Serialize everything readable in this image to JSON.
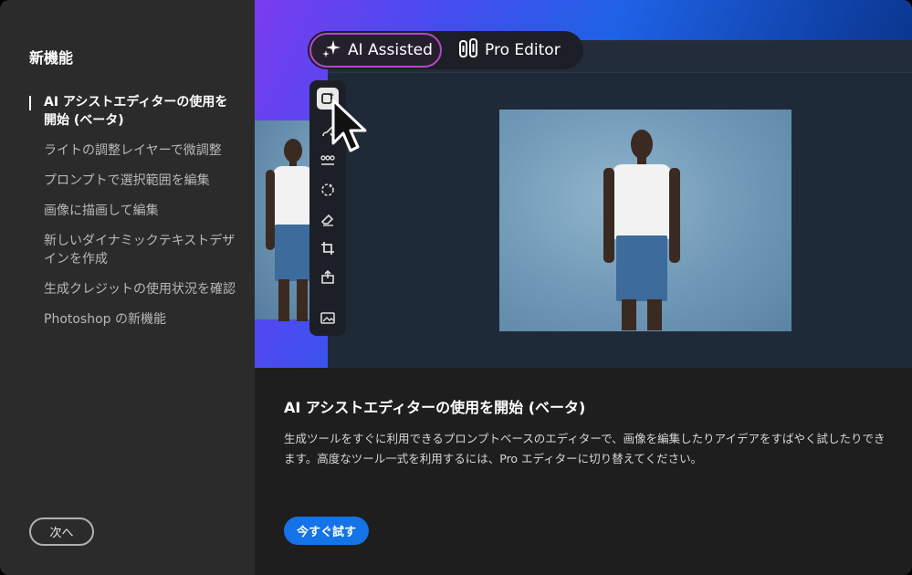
{
  "sidebar": {
    "title": "新機能",
    "items": [
      {
        "label": "AI アシストエディターの使用を開始 (ベータ)",
        "active": true
      },
      {
        "label": "ライトの調整レイヤーで微調整"
      },
      {
        "label": "プロンプトで選択範囲を編集"
      },
      {
        "label": "画像に描画して編集"
      },
      {
        "label": "新しいダイナミックテキストデザインを作成"
      },
      {
        "label": "生成クレジットの使用状況を確認"
      },
      {
        "label": "Photoshop の新機能"
      }
    ],
    "next_label": "次へ"
  },
  "hero": {
    "ai_assisted_label": "AI Assisted",
    "pro_editor_label": "Pro Editor",
    "tools": [
      "generative-tool-icon",
      "brush-icon",
      "adjust-icon",
      "select-icon",
      "eraser-icon",
      "crop-icon",
      "export-icon",
      "image-icon"
    ],
    "accent_color": "#b44ac8"
  },
  "content": {
    "title": "AI アシストエディターの使用を開始 (ベータ)",
    "description": "生成ツールをすぐに利用できるプロンプトベースのエディターで、画像を編集したりアイデアをすばやく試したりできます。高度なツール一式を利用するには、Pro エディターに切り替えてください。",
    "try_label": "今すぐ試す",
    "primary_color": "#1473e6"
  }
}
